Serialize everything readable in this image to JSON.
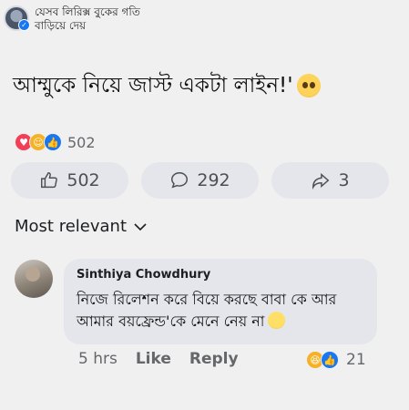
{
  "page": {
    "name": "যেসব লিরিক্স বুকের গতি বাড়িয়ে দেয়"
  },
  "post": {
    "text": "আম্মুকে নিয়ে জাস্ট একটা লাইন!'"
  },
  "reactions": {
    "total": "502",
    "icons": [
      "love-icon",
      "care-icon",
      "like-icon"
    ]
  },
  "actions": {
    "like_count": "502",
    "comment_count": "292",
    "share_count": "3"
  },
  "sort": {
    "label": "Most relevant"
  },
  "comment": {
    "author": "Sinthiya Chowdhury",
    "text": "নিজে রিলেশন করে বিয়ে করছে বাবা কে আর আমার বয়ফ্রেন্ড'কে মেনে নেয় না",
    "time": "5 hrs",
    "like_label": "Like",
    "reply_label": "Reply",
    "reaction_count": "21"
  },
  "colors": {
    "accent": "#1877f2",
    "love": "#f33e58",
    "care": "#f7b125",
    "button_bg": "#e4e6eb"
  }
}
